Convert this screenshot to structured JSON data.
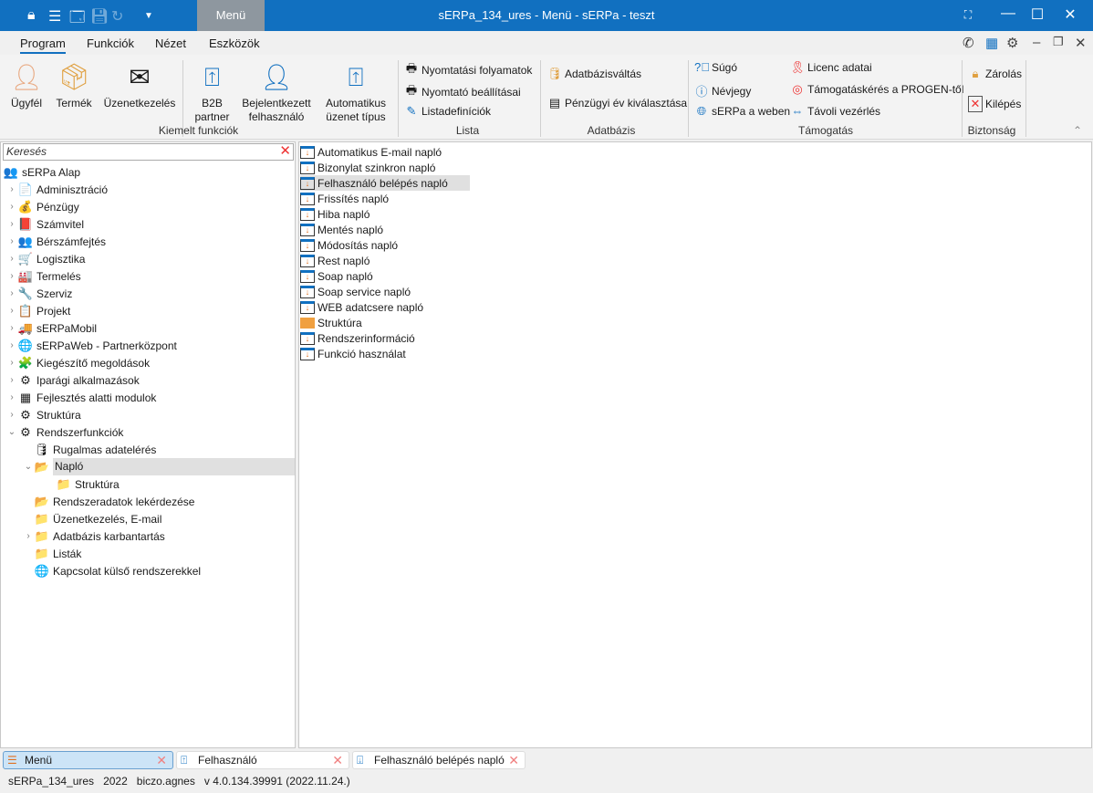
{
  "window": {
    "title": "sERPa_134_ures - Menü - sERPa - teszt",
    "menu_tab": "Menü"
  },
  "ribbon_tabs": [
    "Program",
    "Funkciók",
    "Nézet",
    "Eszközök"
  ],
  "ribbon": {
    "big": [
      {
        "label": "Ügyfél",
        "icon": "person-icon"
      },
      {
        "label": "Termék",
        "icon": "box-icon"
      },
      {
        "label": "Üzenetkezelés",
        "icon": "envelope-icon"
      },
      {
        "label": "B2B\npartner",
        "icon": "upload-window-icon"
      },
      {
        "label": "Bejelentkezett\nfelhasználó",
        "icon": "user-icon"
      },
      {
        "label": "Automatikus\nüzenet típus",
        "icon": "upload-window-icon"
      }
    ],
    "lista": [
      "Nyomtatási folyamatok",
      "Nyomtató beállításai",
      "Listadefiníciók"
    ],
    "adatbazis": [
      "Adatbázisváltás",
      "Pénzügyi év kiválasztása"
    ],
    "tamogatas": [
      "Súgó",
      "Névjegy",
      "sERPa a weben",
      "Licenc adatai",
      "Támogatáskérés a PROGEN-től",
      "Távoli vezérlés"
    ],
    "biztonsag": [
      "Zárolás",
      "Kilépés"
    ],
    "groups": [
      "Kiemelt funkciók",
      "Lista",
      "Adatbázis",
      "Támogatás",
      "Biztonság"
    ]
  },
  "search": {
    "placeholder": "Keresés"
  },
  "tree": [
    {
      "label": "sERPa Alap",
      "level": 0,
      "exp": "",
      "icon": "👥"
    },
    {
      "label": "Adminisztráció",
      "level": 1,
      "exp": ">",
      "icon": "📄"
    },
    {
      "label": "Pénzügy",
      "level": 1,
      "exp": ">",
      "icon": "💰"
    },
    {
      "label": "Számvitel",
      "level": 1,
      "exp": ">",
      "icon": "📕"
    },
    {
      "label": "Bérszámfejtés",
      "level": 1,
      "exp": ">",
      "icon": "👥"
    },
    {
      "label": "Logisztika",
      "level": 1,
      "exp": ">",
      "icon": "🛒"
    },
    {
      "label": "Termelés",
      "level": 1,
      "exp": ">",
      "icon": "🏭"
    },
    {
      "label": "Szerviz",
      "level": 1,
      "exp": ">",
      "icon": "🔧"
    },
    {
      "label": "Projekt",
      "level": 1,
      "exp": ">",
      "icon": "📋"
    },
    {
      "label": "sERPaMobil",
      "level": 1,
      "exp": ">",
      "icon": "🚚"
    },
    {
      "label": "sERPaWeb - Partnerközpont",
      "level": 1,
      "exp": ">",
      "icon": "🌐"
    },
    {
      "label": "Kiegészítő megoldások",
      "level": 1,
      "exp": ">",
      "icon": "🧩"
    },
    {
      "label": "Iparági alkalmazások",
      "level": 1,
      "exp": ">",
      "icon": "⚙"
    },
    {
      "label": "Fejlesztés alatti modulok",
      "level": 1,
      "exp": ">",
      "icon": "▦"
    },
    {
      "label": "Struktúra",
      "level": 1,
      "exp": ">",
      "icon": "⚙"
    },
    {
      "label": "Rendszerfunkciók",
      "level": 1,
      "exp": "v",
      "icon": "⚙"
    },
    {
      "label": "Rugalmas adatelérés",
      "level": 2,
      "exp": "",
      "icon": "🛢"
    },
    {
      "label": "Napló",
      "level": 2,
      "exp": "v",
      "icon": "📂",
      "selected": true
    },
    {
      "label": "Struktúra",
      "level": 3,
      "exp": "",
      "icon": "📁"
    },
    {
      "label": "Rendszeradatok lekérdezése",
      "level": 2,
      "exp": "",
      "icon": "📂"
    },
    {
      "label": "Üzenetkezelés, E-mail",
      "level": 2,
      "exp": "",
      "icon": "📁"
    },
    {
      "label": "Adatbázis karbantartás",
      "level": 2,
      "exp": ">",
      "icon": "📁"
    },
    {
      "label": "Listák",
      "level": 2,
      "exp": "",
      "icon": "📁"
    },
    {
      "label": "Kapcsolat külső rendszerekkel",
      "level": 2,
      "exp": "",
      "icon": "🌐"
    }
  ],
  "list": [
    {
      "label": "Automatikus E-mail napló"
    },
    {
      "label": "Bizonylat szinkron napló"
    },
    {
      "label": "Felhasználó belépés napló",
      "selected": true
    },
    {
      "label": "Frissítés napló"
    },
    {
      "label": "Hiba napló"
    },
    {
      "label": "Mentés napló"
    },
    {
      "label": "Módosítás napló"
    },
    {
      "label": "Rest napló"
    },
    {
      "label": "Soap napló"
    },
    {
      "label": "Soap service napló"
    },
    {
      "label": "WEB adatcsere napló"
    },
    {
      "label": "Struktúra",
      "folder": true
    },
    {
      "label": "Rendszerinformáció"
    },
    {
      "label": "Funkció használat"
    }
  ],
  "bottom_tabs": [
    {
      "label": "Menü",
      "active": true
    },
    {
      "label": "Felhasználó"
    },
    {
      "label": "Felhasználó belépés napló"
    }
  ],
  "status": {
    "db": "sERPa_134_ures",
    "year": "2022",
    "user": "biczo.agnes",
    "version": "v 4.0.134.39991 (2022.11.24.)"
  }
}
